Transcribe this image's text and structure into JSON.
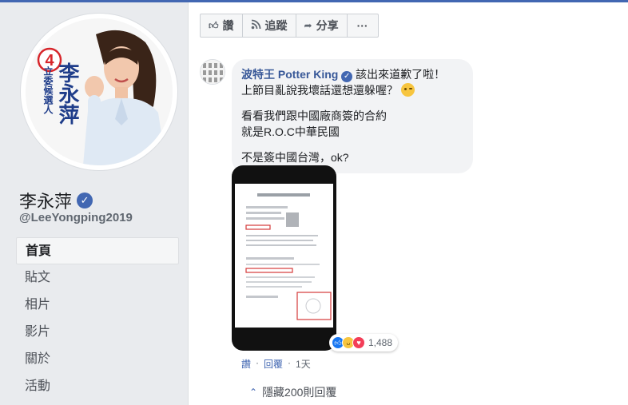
{
  "page": {
    "name": "李永萍",
    "handle": "@LeeYongping2019",
    "avatar_number": "4",
    "avatar_title": "李永萍",
    "avatar_subtitle": "立委候選人",
    "nav": [
      {
        "label": "首頁",
        "active": true
      },
      {
        "label": "貼文",
        "active": false
      },
      {
        "label": "相片",
        "active": false
      },
      {
        "label": "影片",
        "active": false
      },
      {
        "label": "關於",
        "active": false
      },
      {
        "label": "活動",
        "active": false
      }
    ]
  },
  "actions": {
    "read_label": "讚",
    "follow_label": "追蹤",
    "share_label": "分享",
    "more_label": "···"
  },
  "comment": {
    "author": "波特王 Potter King",
    "line1": "該出來道歉了啦！",
    "line2": "上節目亂說我壞話還想還躲喔？",
    "line3": "看看我們跟中國廠商簽的合約",
    "line4": "就是R.O.C中華民國",
    "line5": "不是簽中國台灣，ok?",
    "reaction_count": "1,488",
    "like_label": "讚",
    "reply_label": "回覆",
    "time": "1天"
  },
  "replies": {
    "collapse_label": "隱藏200則回覆"
  },
  "colors": {
    "brand": "#4267b2",
    "link": "#385898",
    "bubble": "#f2f3f5"
  }
}
